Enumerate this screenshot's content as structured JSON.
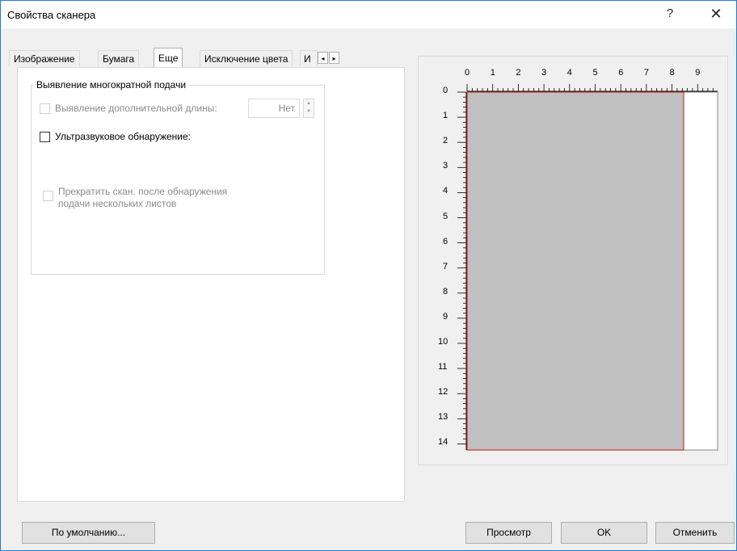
{
  "window": {
    "title": "Свойства сканера",
    "help_label": "?",
    "close_label": "✕"
  },
  "tabs": [
    {
      "label": "Изображение",
      "active": false
    },
    {
      "label": "Бумага",
      "active": false
    },
    {
      "label": "Еще",
      "active": true
    },
    {
      "label": "Исключение цвета",
      "active": false
    },
    {
      "label": "И",
      "active": false
    }
  ],
  "tab_scroll": {
    "left": "◂",
    "right": "▸"
  },
  "group": {
    "title": "Выявление многократной подачи",
    "extra_length": {
      "label": "Выявление дополнительной длины:",
      "checked": false,
      "enabled": false,
      "value": "Нет"
    },
    "ultrasonic": {
      "label": "Ультразвуковое обнаружение:",
      "checked": false,
      "enabled": true
    },
    "stop_scan": {
      "label_line1": "Прекратить скан. после обнаружения",
      "label_line2": "подачи нескольких листов",
      "checked": false,
      "enabled": false
    }
  },
  "preview": {
    "top_ruler": [
      "0",
      "1",
      "2",
      "3",
      "4",
      "5",
      "6",
      "7",
      "8",
      "9"
    ],
    "left_ruler": [
      "0",
      "1",
      "2",
      "3",
      "4",
      "5",
      "6",
      "7",
      "8",
      "9",
      "10",
      "11",
      "12",
      "13",
      "14"
    ],
    "page_color": "#c0c0c0",
    "page_border_color": "#c0392b"
  },
  "buttons": {
    "defaults": "По умолчанию...",
    "preview": "Просмотр",
    "ok": "OK",
    "cancel": "Отменить"
  }
}
